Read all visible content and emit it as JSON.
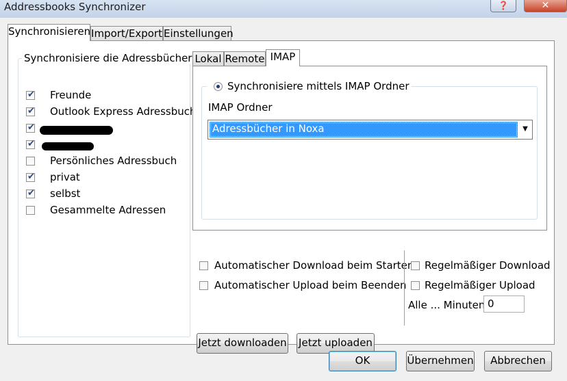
{
  "window": {
    "title": "Addressbooks Synchronizer"
  },
  "tabs": {
    "main": [
      "Synchronisieren",
      "Import/Export",
      "Einstellungen"
    ],
    "sub": [
      "Lokal",
      "Remote",
      "IMAP"
    ]
  },
  "addressbooks": {
    "group_title": "Synchronisiere die Adressbücher",
    "items": [
      {
        "label": "Freunde",
        "checked": true
      },
      {
        "label": "Outlook Express Adressbuch",
        "checked": true
      },
      {
        "label": "",
        "checked": true,
        "redacted": true
      },
      {
        "label": "",
        "checked": true,
        "redacted": true
      },
      {
        "label": "Persönliches Adressbuch",
        "checked": false
      },
      {
        "label": "privat",
        "checked": true
      },
      {
        "label": "selbst",
        "checked": true
      },
      {
        "label": "Gesammelte Adressen",
        "checked": false
      }
    ]
  },
  "imap": {
    "radio_label": "Synchronisiere mittels IMAP Ordner",
    "folder_label": "IMAP Ordner",
    "folder_value": "Adressbücher in Noxa"
  },
  "options": {
    "auto_download": "Automatischer Download beim Starten",
    "auto_upload": "Automatischer Upload beim Beenden",
    "regular_download": "Regelmäßiger Download",
    "regular_upload": "Regelmäßiger Upload",
    "interval_label": "Alle ... Minuten",
    "interval_value": "0"
  },
  "buttons": {
    "download_now": "Jetzt downloaden",
    "upload_now": "Jetzt uploaden",
    "ok": "OK",
    "apply": "Übernehmen",
    "cancel": "Abbrechen"
  }
}
